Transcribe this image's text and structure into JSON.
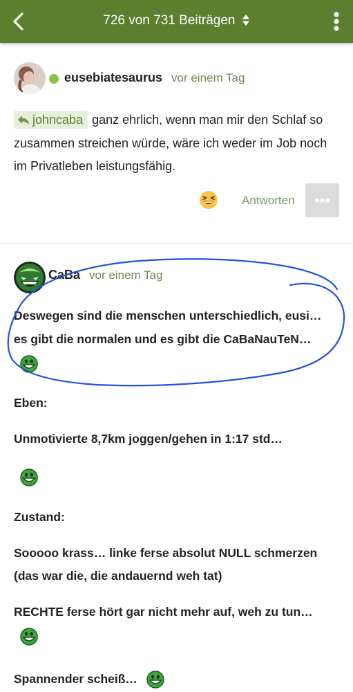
{
  "topbar": {
    "title": "726 von 731 Beiträgen",
    "back_icon": "chevron-left-icon",
    "sort_icon": "sort-updown-icon",
    "menu_icon": "vertical-dots-icon"
  },
  "colors": {
    "brand_green": "#5b7f2e",
    "online": "#8bc34a",
    "meta_text": "#6f8a52",
    "annotation_blue": "#2150e0"
  },
  "post1": {
    "username": "eusebiatesaurus",
    "time": "vor einem Tag",
    "quote_user": "johncaba",
    "text": "ganz ehrlich, wenn man mir den Schlaf so zusammen streichen würde, wäre ich weder im Job noch im Privatleben leistungsfähig.",
    "reaction_icon": "laughing-emoji-icon",
    "reply_label": "Antworten",
    "more_label": "•••"
  },
  "post2": {
    "username": "CaBa",
    "time": "vor einem Tag",
    "lines": [
      "Deswegen sind die menschen unterschiedlich, eusi…",
      "es gibt die normalen und es gibt die CaBaNauTeN…",
      "Eben:",
      "Unmotivierte 8,7km joggen/gehen in 1:17 std…",
      "Zustand:",
      "Sooooo krass… linke ferse absolut NULL schmerzen",
      "(das war die, die andauernd weh tat)",
      "RECHTE ferse hört gar nicht mehr auf, weh zu tun…",
      "Spannender scheiß…"
    ],
    "smiley_icon": "green-grin-smiley-icon"
  }
}
